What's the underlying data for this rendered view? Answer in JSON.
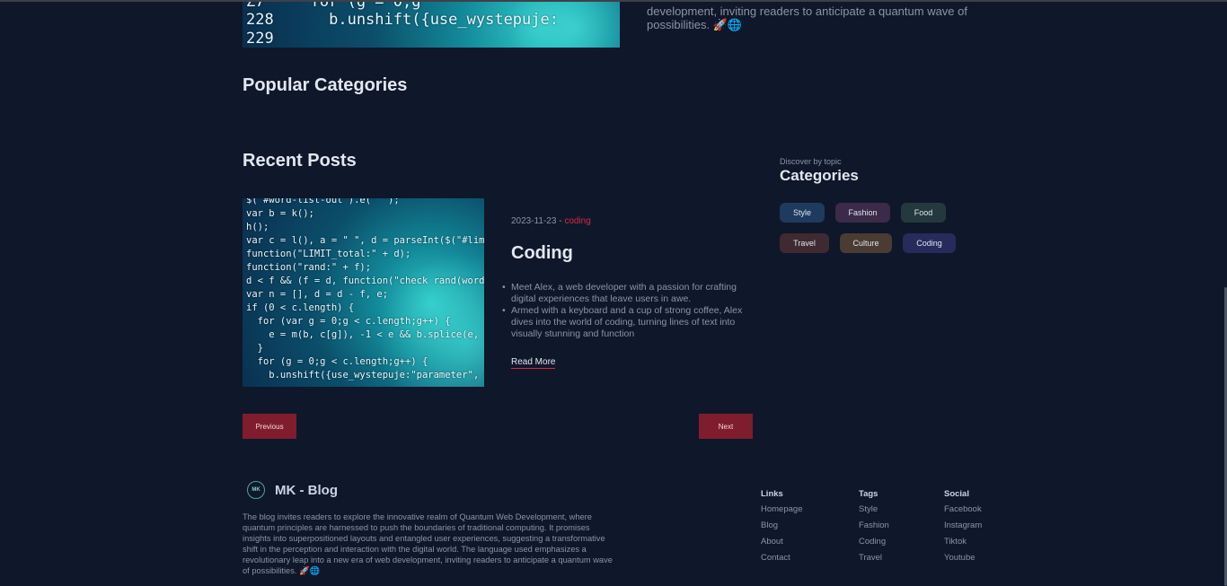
{
  "top_post": {
    "code_text": "Z7     for (g = 0;g\n228      b.unshift({use_wystepuje:\n229",
    "description_tail": "development, inviting readers to anticipate a quantum wave of possibilities. 🚀🌐"
  },
  "sections": {
    "popular_title": "Popular Categories",
    "recent_title": "Recent Posts"
  },
  "recent_post": {
    "code_text": "$(\"#word-list-out\").e(\" \");\nvar b = k();\nh();\nvar c = l(), a = \" \", d = parseInt($(\"#limit_val\").a()\nfunction(\"LIMIT_total:\" + d);\nfunction(\"rand:\" + f);\nd < f && (f = d, function(\"check rand(word)\")\nvar n = [], d = d - f, e;\nif (0 < c.length) {\n  for (var g = 0;g < c.length;g++) {\n    e = m(b, c[g]), -1 < e && b.splice(e, 1)\n  }\n  for (g = 0;g < c.length;g++) {\n    b.unshift({use_wystepuje:\"parameter\", word:c[g]})",
    "date": "2023-11-23",
    "separator": " - ",
    "category": "coding",
    "title": "Coding",
    "bullets": [
      "Meet Alex, a web developer with a passion for crafting digital experiences that leave users in awe.",
      "Armed with a keyboard and a cup of strong coffee, Alex dives into the world of coding, turning lines of text into visually stunning and function"
    ],
    "read_more": "Read More"
  },
  "sidebar": {
    "subtitle": "Discover by topic",
    "title": "Categories",
    "chips": [
      {
        "label": "Style",
        "color": "#1e3a5f"
      },
      {
        "label": "Fashion",
        "color": "#3b2a4a"
      },
      {
        "label": "Food",
        "color": "#24393d"
      },
      {
        "label": "Travel",
        "color": "#3f2a31"
      },
      {
        "label": "Culture",
        "color": "#4a3b33"
      },
      {
        "label": "Coding",
        "color": "#262b5c"
      }
    ]
  },
  "pagination": {
    "previous": "Previous",
    "next": "Next"
  },
  "footer": {
    "logo_text": "MK",
    "brand": "MK - Blog",
    "description": "The blog invites readers to explore the innovative realm of Quantum Web Development, where quantum principles are harnessed to push the boundaries of traditional computing. It promises insights into superpositioned layouts and entangled user experiences, suggesting a transformative shift in the perception and interaction with the digital world. The language used emphasizes a revolutionary leap into a new era of web development, inviting readers to anticipate a quantum wave of possibilities. 🚀🌐",
    "columns": [
      {
        "title": "Links",
        "items": [
          "Homepage",
          "Blog",
          "About",
          "Contact"
        ]
      },
      {
        "title": "Tags",
        "items": [
          "Style",
          "Fashion",
          "Coding",
          "Travel"
        ]
      },
      {
        "title": "Social",
        "items": [
          "Facebook",
          "Instagram",
          "Tiktok",
          "Youtube"
        ]
      }
    ]
  },
  "colors": {
    "background": "#0f172a",
    "accent": "#dc2643",
    "button": "#7f1d2e"
  }
}
